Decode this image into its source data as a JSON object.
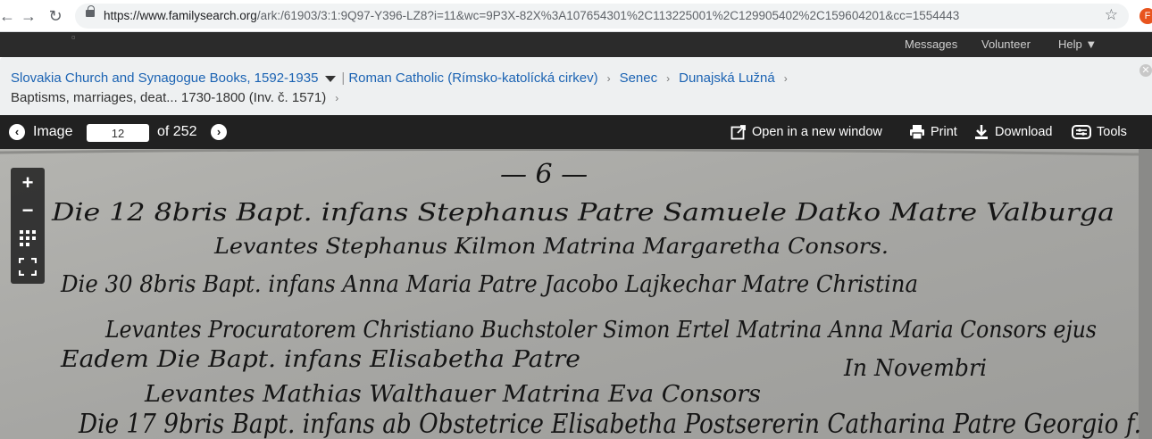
{
  "browser": {
    "url_host": "https://www.familysearch.org",
    "url_path": "/ark:/61903/3:1:9Q97-Y396-LZ8?i=11&wc=9P3X-82X%3A107654301%2C113225001%2C129905402%2C159604201&cc=1554443",
    "profile_initial": "F"
  },
  "site_nav": {
    "messages": "Messages",
    "volunteer": "Volunteer",
    "help": "Help ▼"
  },
  "breadcrumb": {
    "collection": "Slovakia Church and Synagogue Books, 1592-1935",
    "religion": "Roman Catholic (Rímsko-katolícká cirkev)",
    "county": "Senec",
    "town": "Dunajská Lužná",
    "volume": "Baptisms, marriages, deat... 1730-1800 (Inv. č. 1571)"
  },
  "toolbar": {
    "image_label": "Image",
    "current_page": "12",
    "of_total": "of 252",
    "open_new_window": "Open in a new window",
    "print": "Print",
    "download": "Download",
    "tools": "Tools"
  },
  "document": {
    "lines": [
      "— 6 —",
      "Die 12 8bris Bapt. infans Stephanus Patre Samuele Datko Matre Valburga",
      "Levantes Stephanus Kilmon Matrina Margaretha Consors.",
      "Die 30 8bris Bapt. infans Anna Maria Patre Jacobo Lajkechar Matre Christina",
      "Levantes Procuratorem Christiano Buchstoler Simon Ertel Matrina Anna Maria Consors ejus",
      "Eadem Die Bapt. infans Elisabetha Patre",
      "In Novembri",
      "Levantes Mathias Walthauer Matrina Eva Consors",
      "Die 17 9bris Bapt. infans ab Obstetrice Elisabetha Postsererin Catharina Patre Georgio f."
    ]
  }
}
